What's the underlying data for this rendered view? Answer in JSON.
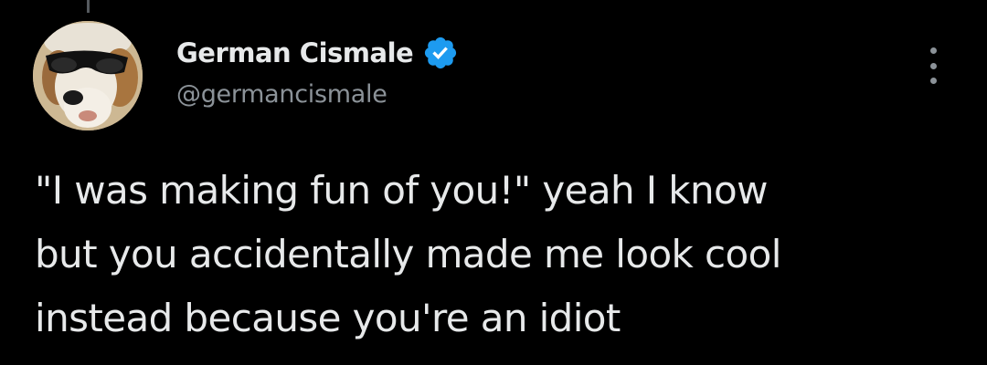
{
  "author": {
    "display_name": "German Cismale",
    "handle": "@germancismale",
    "verified_color": "#1d9bf0"
  },
  "tweet": {
    "text": "\"I was making fun of you!\" yeah I know\nbut you accidentally made me look cool\ninstead because you're an idiot"
  },
  "icons": {
    "verified": "verified-badge-icon",
    "more": "more-options-icon"
  },
  "colors": {
    "background": "#000000",
    "text": "#e7e9ea",
    "secondary_text": "#8b9298"
  }
}
